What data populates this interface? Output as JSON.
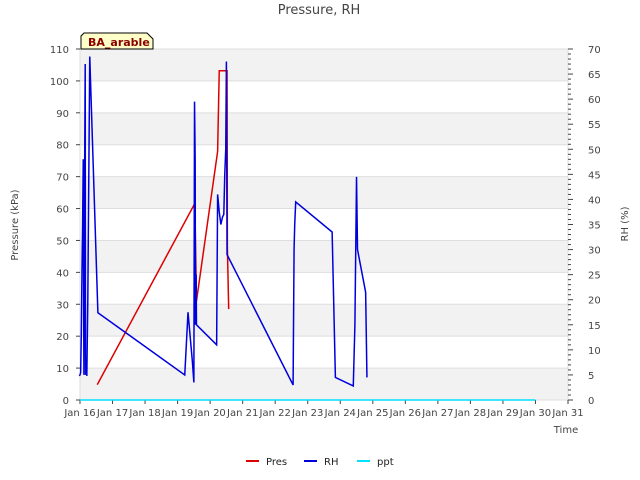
{
  "chart_data": {
    "type": "line",
    "title": "Pressure, RH",
    "xlabel": "Time",
    "ylabel_left": "Pressure (kPa)",
    "ylabel_right": "RH (%)",
    "badge": "BA_arable",
    "x_ticks": [
      "Jan 16",
      "Jan 17",
      "Jan 18",
      "Jan 19",
      "Jan 20",
      "Jan 21",
      "Jan 22",
      "Jan 23",
      "Jan 24",
      "Jan 25",
      "Jan 26",
      "Jan 27",
      "Jan 28",
      "Jan 29",
      "Jan 30",
      "Jan 31"
    ],
    "xlim": [
      16,
      31
    ],
    "ylim_left": [
      0,
      110
    ],
    "ylim_right": [
      0,
      70
    ],
    "y_ticks_left": [
      0,
      10,
      20,
      30,
      40,
      50,
      60,
      70,
      80,
      90,
      100,
      110
    ],
    "y_ticks_right": [
      0,
      5,
      10,
      15,
      20,
      25,
      30,
      35,
      40,
      45,
      50,
      55,
      60,
      65,
      70
    ],
    "grid": true,
    "legend_position": "bottom",
    "series": [
      {
        "name": "Pres",
        "color": "#dd0000",
        "axis": "left",
        "points": [
          [
            16.53,
            4.8
          ],
          [
            19.53,
            61.6
          ],
          [
            19.58,
            31.0
          ],
          [
            20.23,
            77.9
          ],
          [
            20.28,
            103.2
          ],
          [
            20.52,
            103.2
          ],
          [
            20.53,
            48.0
          ],
          [
            20.57,
            28.5
          ]
        ]
      },
      {
        "name": "RH",
        "color": "#0000dd",
        "axis": "right",
        "points": [
          [
            15.98,
            4.8
          ],
          [
            16.0,
            5.0
          ],
          [
            16.02,
            5.5
          ],
          [
            16.04,
            13.0
          ],
          [
            16.06,
            25.0
          ],
          [
            16.08,
            35.0
          ],
          [
            16.1,
            48.0
          ],
          [
            16.12,
            5.0
          ],
          [
            16.14,
            42.0
          ],
          [
            16.16,
            67.0
          ],
          [
            16.17,
            5.0
          ],
          [
            16.19,
            8.0
          ],
          [
            16.21,
            4.8
          ],
          [
            16.24,
            20.0
          ],
          [
            16.3,
            68.5
          ],
          [
            16.55,
            17.4
          ],
          [
            19.22,
            5.0
          ],
          [
            19.32,
            17.5
          ],
          [
            19.45,
            8.0
          ],
          [
            19.5,
            3.5
          ],
          [
            19.52,
            59.5
          ],
          [
            19.54,
            48.0
          ],
          [
            19.55,
            15.0
          ],
          [
            19.57,
            25.0
          ],
          [
            19.58,
            15.0
          ],
          [
            20.2,
            11.0
          ],
          [
            20.23,
            41.0
          ],
          [
            20.28,
            37.5
          ],
          [
            20.33,
            35.0
          ],
          [
            20.38,
            36.5
          ],
          [
            20.42,
            37.0
          ],
          [
            20.45,
            45.0
          ],
          [
            20.48,
            50.0
          ],
          [
            20.5,
            67.5
          ],
          [
            20.52,
            29.0
          ],
          [
            22.55,
            3.0
          ],
          [
            22.58,
            30.0
          ],
          [
            22.6,
            35.0
          ],
          [
            22.63,
            39.5
          ],
          [
            23.75,
            33.5
          ],
          [
            23.85,
            4.5
          ],
          [
            24.4,
            2.8
          ],
          [
            24.45,
            15.0
          ],
          [
            24.5,
            44.5
          ],
          [
            24.53,
            30.0
          ],
          [
            24.78,
            21.5
          ],
          [
            24.82,
            4.5
          ]
        ]
      },
      {
        "name": "ppt",
        "color": "#00e0ff",
        "axis": "left",
        "points": [
          [
            16.0,
            0
          ],
          [
            30.0,
            0
          ]
        ]
      }
    ]
  }
}
